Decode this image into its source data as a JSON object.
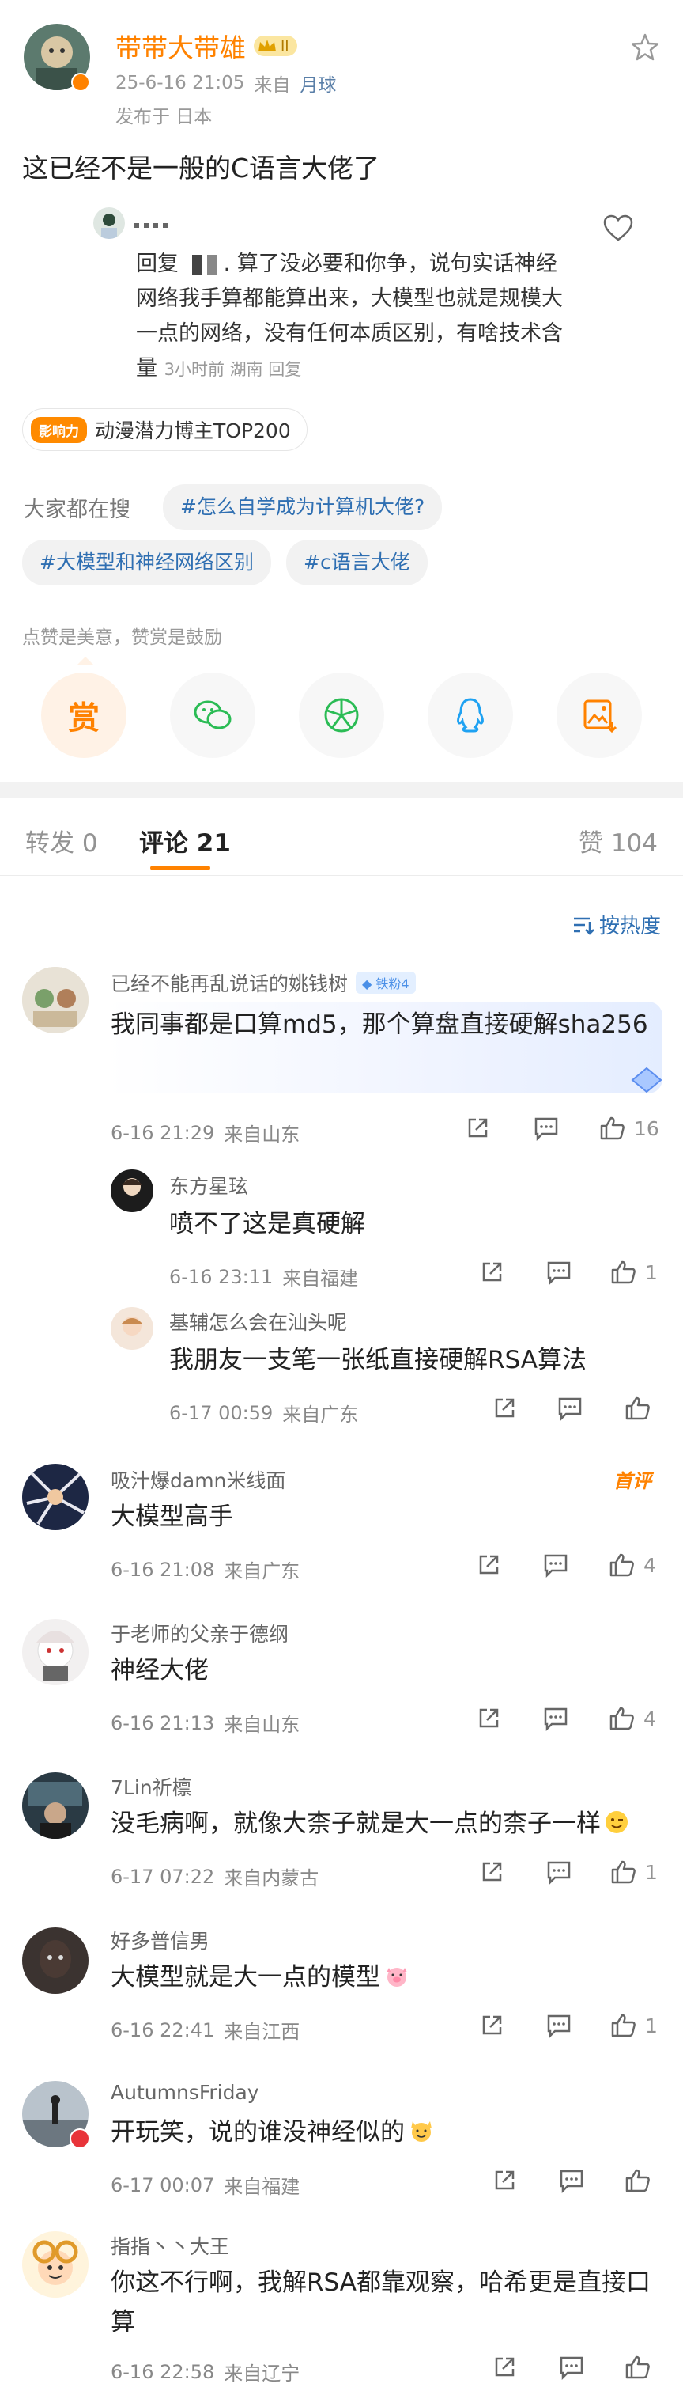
{
  "post": {
    "author": "带带大带雄",
    "level_badge": "II",
    "time": "25-6-16 21:05",
    "source_prefix": "来自",
    "source": "月球",
    "location": "发布于 日本",
    "text": "这已经不是一般的C语言大佬了"
  },
  "quote": {
    "reply_prefix": "回复",
    "text": "算了没必要和你争，说句实话神经网络我手算都能算出来，大模型也就是规模大一点的网络，没有任何本质区别，有啥技术含量",
    "meta": "3小时前 湖南 回复"
  },
  "influence": {
    "badge": "影响力",
    "text": "动漫潜力博主TOP200"
  },
  "search": {
    "label": "大家都在搜",
    "topics": [
      "#怎么自学成为计算机大佬?",
      "#大模型和神经网络区别",
      "#c语言大佬"
    ]
  },
  "reward_hint": "点赞是美意，赞赏是鼓励",
  "reward_label": "赏",
  "tabs": {
    "repost": "转发 0",
    "comment": "评论 21",
    "like": "赞 104"
  },
  "sort_label": "按热度",
  "comments": [
    {
      "name": "已经不能再乱说话的姚钱树",
      "fan": "铁粉4",
      "text": "我同事都是口算md5，那个算盘直接硬解sha256",
      "time": "6-16 21:29",
      "loc": "来自山东",
      "likes": "16"
    },
    {
      "name": "东方星玹",
      "text": "喷不了这是真硬解",
      "time": "6-16 23:11",
      "loc": "来自福建",
      "likes": "1"
    },
    {
      "name": "基辅怎么会在汕头呢",
      "text": "我朋友一支笔一张纸直接硬解RSA算法",
      "time": "6-17 00:59",
      "loc": "来自广东",
      "likes": ""
    },
    {
      "name": "吸汁爆damn米线面",
      "tag": "首评",
      "text": "大模型高手",
      "time": "6-16 21:08",
      "loc": "来自广东",
      "likes": "4"
    },
    {
      "name": "于老师的父亲于德纲",
      "text": "神经大佬",
      "time": "6-16 21:13",
      "loc": "来自山东",
      "likes": "4"
    },
    {
      "name": "7Lin祈檩",
      "text": "没毛病啊，就像大柰子就是大一点的柰子一样",
      "time": "6-17 07:22",
      "loc": "来自内蒙古",
      "likes": "1"
    },
    {
      "name": "好多普信男",
      "text": "大模型就是大一点的模型",
      "time": "6-16 22:41",
      "loc": "来自江西",
      "likes": "1"
    },
    {
      "name": "AutumnsFriday",
      "text": "开玩笑，说的谁没神经似的",
      "time": "6-17 00:07",
      "loc": "来自福建",
      "likes": ""
    },
    {
      "name": "指指丶丶大王",
      "text": "你这不行啊，我解RSA都靠观察，哈希更是直接口算",
      "time": "6-16 22:58",
      "loc": "来自辽宁",
      "likes": ""
    }
  ]
}
